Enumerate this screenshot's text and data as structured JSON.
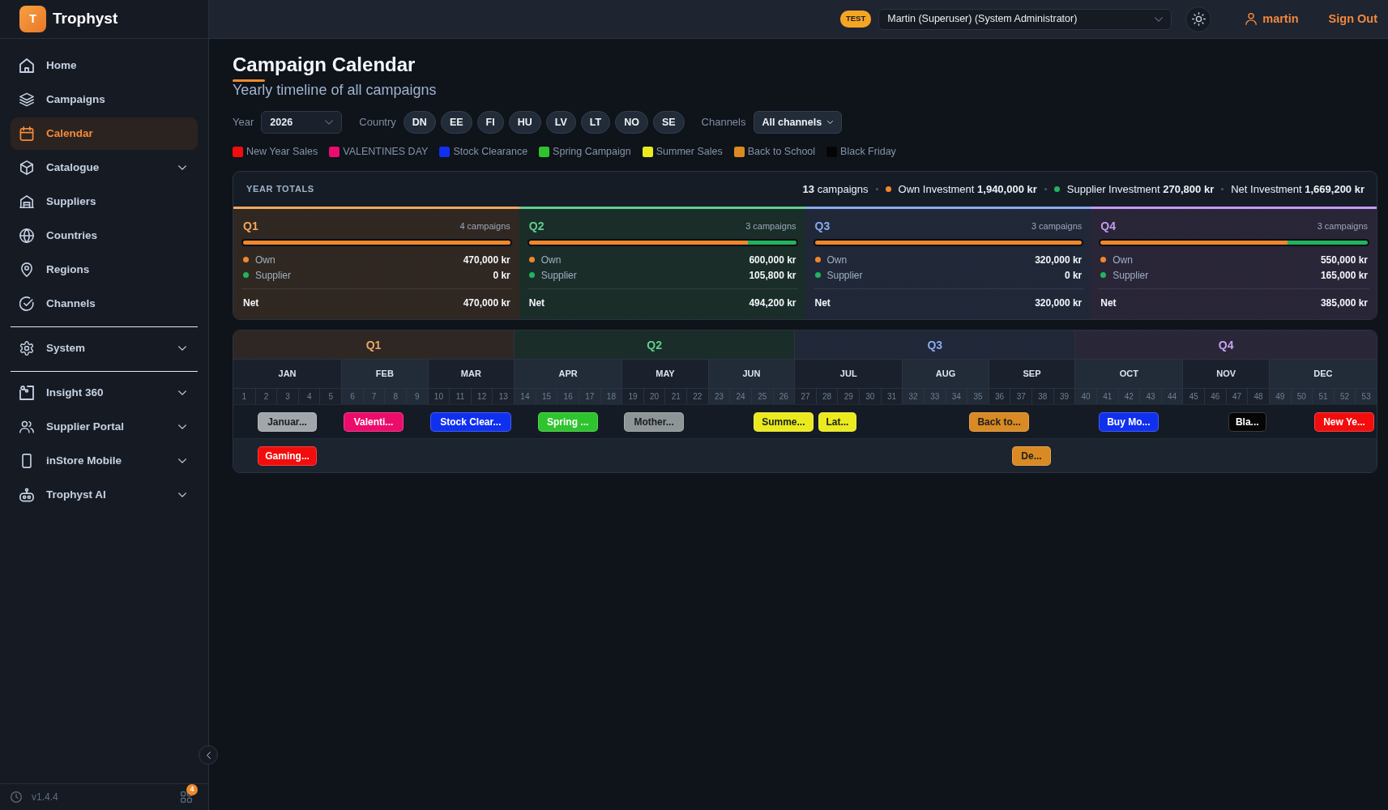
{
  "sidebar": {
    "brand": {
      "initial": "T",
      "name": "Trophyst"
    },
    "groups": [
      {
        "items": [
          {
            "label": "Home",
            "selected": false
          },
          {
            "label": "Campaigns",
            "selected": false
          },
          {
            "label": "Calendar",
            "selected": true
          },
          {
            "label": "Catalogue",
            "selected": false,
            "expanded": false
          },
          {
            "label": "Suppliers",
            "selected": false
          },
          {
            "label": "Countries",
            "selected": false
          },
          {
            "label": "Regions",
            "selected": false
          },
          {
            "label": "Channels",
            "selected": false
          }
        ]
      },
      {
        "items": [
          {
            "label": "System",
            "selected": false,
            "expanded": false
          }
        ]
      },
      {
        "items": [
          {
            "label": "Insight 360",
            "selected": false,
            "expanded": false
          },
          {
            "label": "Supplier Portal",
            "selected": false,
            "expanded": false
          },
          {
            "label": "inStore Mobile",
            "selected": false,
            "expanded": false
          },
          {
            "label": "Trophyst AI",
            "selected": false,
            "expanded": false
          }
        ]
      }
    ],
    "version": "v1.4.4",
    "apps_badge": "4"
  },
  "top_bar": {
    "environment": "TEST",
    "role_select": {
      "value": "Martin (Superuser) (System Administrator)"
    },
    "user": "martin",
    "sign_out": "Sign Out"
  },
  "header": {
    "title": "Campaign Calendar",
    "subtitle": "Yearly timeline of all campaigns"
  },
  "filters": {
    "year": {
      "label": "Year",
      "value": "2026"
    },
    "country": {
      "label": "Country",
      "options": [
        {
          "label": "DN",
          "selected": false
        },
        {
          "label": "EE",
          "selected": false
        },
        {
          "label": "FI",
          "selected": false
        },
        {
          "label": "HU",
          "selected": false
        },
        {
          "label": "LV",
          "selected": false
        },
        {
          "label": "LT",
          "selected": false
        },
        {
          "label": "NO",
          "selected": false
        },
        {
          "label": "SE",
          "selected": false
        }
      ]
    },
    "channels": {
      "label": "Channels",
      "value": "All channels"
    }
  },
  "legend": [
    {
      "label": "New Year Sales",
      "color": "#f20d0d"
    },
    {
      "label": "VALENTINES DAY",
      "color": "#ec0c6c"
    },
    {
      "label": "Stock Clearance",
      "color": "#1030f0"
    },
    {
      "label": "Spring Campaign",
      "color": "#2ec42e"
    },
    {
      "label": "Summer Sales",
      "color": "#eaea1e"
    },
    {
      "label": "Back to School",
      "color": "#d98a22"
    },
    {
      "label": "Black Friday",
      "color": "#050505"
    }
  ],
  "year_totals": {
    "title": "YEAR TOTALS",
    "stats": [
      {
        "text": "**13** campaigns"
      },
      {
        "text": "Own Investment **1,940,000 kr**",
        "color": "#f0872a"
      },
      {
        "text": "Supplier Investment **270,800 kr**",
        "color": "#22b35e"
      },
      {
        "text": "Net Investment **1,669,200 kr**"
      }
    ],
    "quarters": [
      {
        "label": "Q1",
        "color": "#f2a85e",
        "count": "4 campaigns",
        "level": 1,
        "rows": [
          {
            "label": "Own",
            "value": "470,000 kr",
            "color": "#f0872a"
          },
          {
            "label": "Supplier",
            "value": "0 kr",
            "color": "#22b35e"
          }
        ],
        "net": {
          "label": "Net",
          "value": "470,000 kr"
        }
      },
      {
        "label": "Q2",
        "color": "#5fcf8f",
        "count": "3 campaigns",
        "level": 0.82,
        "rows": [
          {
            "label": "Own",
            "value": "600,000 kr",
            "color": "#f0872a"
          },
          {
            "label": "Supplier",
            "value": "105,800 kr",
            "color": "#22b35e"
          }
        ],
        "net": {
          "label": "Net",
          "value": "494,200 kr"
        }
      },
      {
        "label": "Q3",
        "color": "#8aaaf0",
        "count": "3 campaigns",
        "level": 1,
        "rows": [
          {
            "label": "Own",
            "value": "320,000 kr",
            "color": "#f0872a"
          },
          {
            "label": "Supplier",
            "value": "0 kr",
            "color": "#22b35e"
          }
        ],
        "net": {
          "label": "Net",
          "value": "320,000 kr"
        }
      },
      {
        "label": "Q4",
        "color": "#c49af2",
        "count": "3 campaigns",
        "level": 0.7,
        "rows": [
          {
            "label": "Own",
            "value": "550,000 kr",
            "color": "#f0872a"
          },
          {
            "label": "Supplier",
            "value": "165,000 kr",
            "color": "#22b35e"
          }
        ],
        "net": {
          "label": "Net",
          "value": "385,000 kr"
        }
      }
    ]
  },
  "timeline": {
    "quarters": [
      {
        "label": "Q1",
        "color": "#eaa866",
        "months": [
          {
            "label": "JAN",
            "weeks": [
              "1",
              "2",
              "3",
              "4",
              "5"
            ]
          },
          {
            "label": "FEB",
            "weeks": [
              "6",
              "7",
              "8",
              "9"
            ]
          },
          {
            "label": "MAR",
            "weeks": [
              "10",
              "11",
              "12",
              "13"
            ]
          }
        ]
      },
      {
        "label": "Q2",
        "color": "#5fcf8f",
        "months": [
          {
            "label": "APR",
            "weeks": [
              "14",
              "15",
              "16",
              "17",
              "18"
            ]
          },
          {
            "label": "MAY",
            "weeks": [
              "19",
              "20",
              "21",
              "22"
            ]
          },
          {
            "label": "JUN",
            "weeks": [
              "23",
              "24",
              "25",
              "26"
            ]
          }
        ]
      },
      {
        "label": "Q3",
        "color": "#8aaaf0",
        "months": [
          {
            "label": "JUL",
            "weeks": [
              "27",
              "28",
              "29",
              "30",
              "31"
            ]
          },
          {
            "label": "AUG",
            "weeks": [
              "32",
              "33",
              "34",
              "35"
            ]
          },
          {
            "label": "SEP",
            "weeks": [
              "36",
              "37",
              "38",
              "39"
            ]
          }
        ]
      },
      {
        "label": "Q4",
        "color": "#c8a2f2",
        "months": [
          {
            "label": "OCT",
            "weeks": [
              "40",
              "41",
              "42",
              "43",
              "44"
            ]
          },
          {
            "label": "NOV",
            "weeks": [
              "45",
              "46",
              "47",
              "48"
            ]
          },
          {
            "label": "DEC",
            "weeks": [
              "49",
              "50",
              "51",
              "52",
              "53"
            ]
          }
        ]
      }
    ],
    "rows": [
      {
        "campaigns": [
          {
            "label": "Januar...",
            "color": "#a0a6a9"
          },
          {
            "label": "Valenti...",
            "color": "#ec0c6c"
          },
          {
            "label": "Stock Clear...",
            "color": "#1030f0"
          },
          {
            "label": "Spring ...",
            "color": "#2ec42e"
          },
          {
            "label": "Mother...",
            "color": "#8e9596"
          },
          {
            "label": "Summe...",
            "color": "#eaea1e"
          },
          {
            "label": "Lat...",
            "color": "#eaea1e"
          },
          {
            "label": "Back to...",
            "color": "#d98a22"
          },
          {
            "label": "Buy Mo...",
            "color": "#1030f0"
          },
          {
            "label": "Bla...",
            "color": "#050505"
          },
          {
            "label": "New Ye...",
            "color": "#f20d0d"
          }
        ]
      },
      {
        "campaigns": [
          {
            "label": "Gaming...",
            "color": "#f20d0d"
          },
          {
            "label": "De...",
            "color": "#d98a22"
          }
        ]
      }
    ]
  }
}
